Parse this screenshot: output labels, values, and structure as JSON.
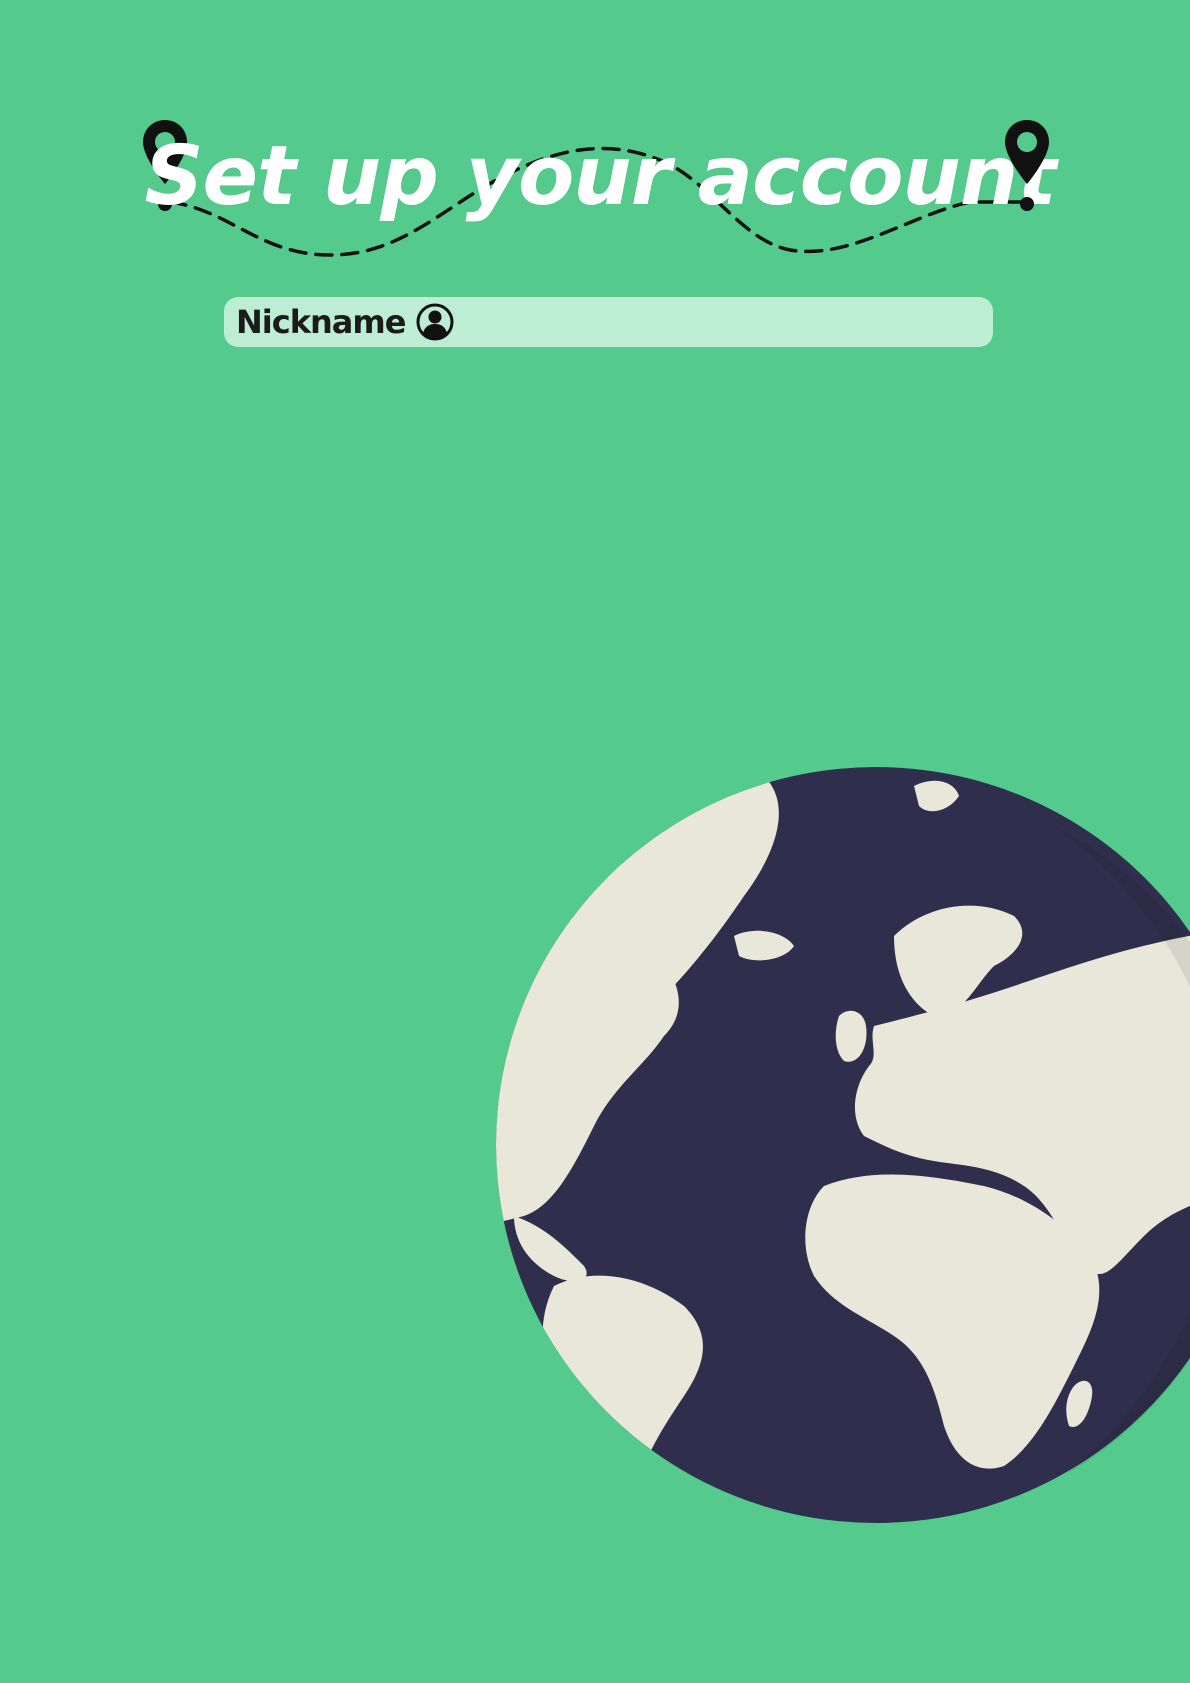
{
  "header": {
    "title": "Set up your account"
  },
  "form": {
    "nickname": {
      "label": "Nickname",
      "value": "",
      "icon": "user-circle-icon"
    }
  },
  "illustration": {
    "icon": "globe-icon"
  },
  "colors": {
    "background": "#54cb8c",
    "field_background": "#bdeed4",
    "title_text": "#ffffff",
    "ocean": "#2f2f4d",
    "land": "#e9e6da",
    "ink": "#111111"
  }
}
